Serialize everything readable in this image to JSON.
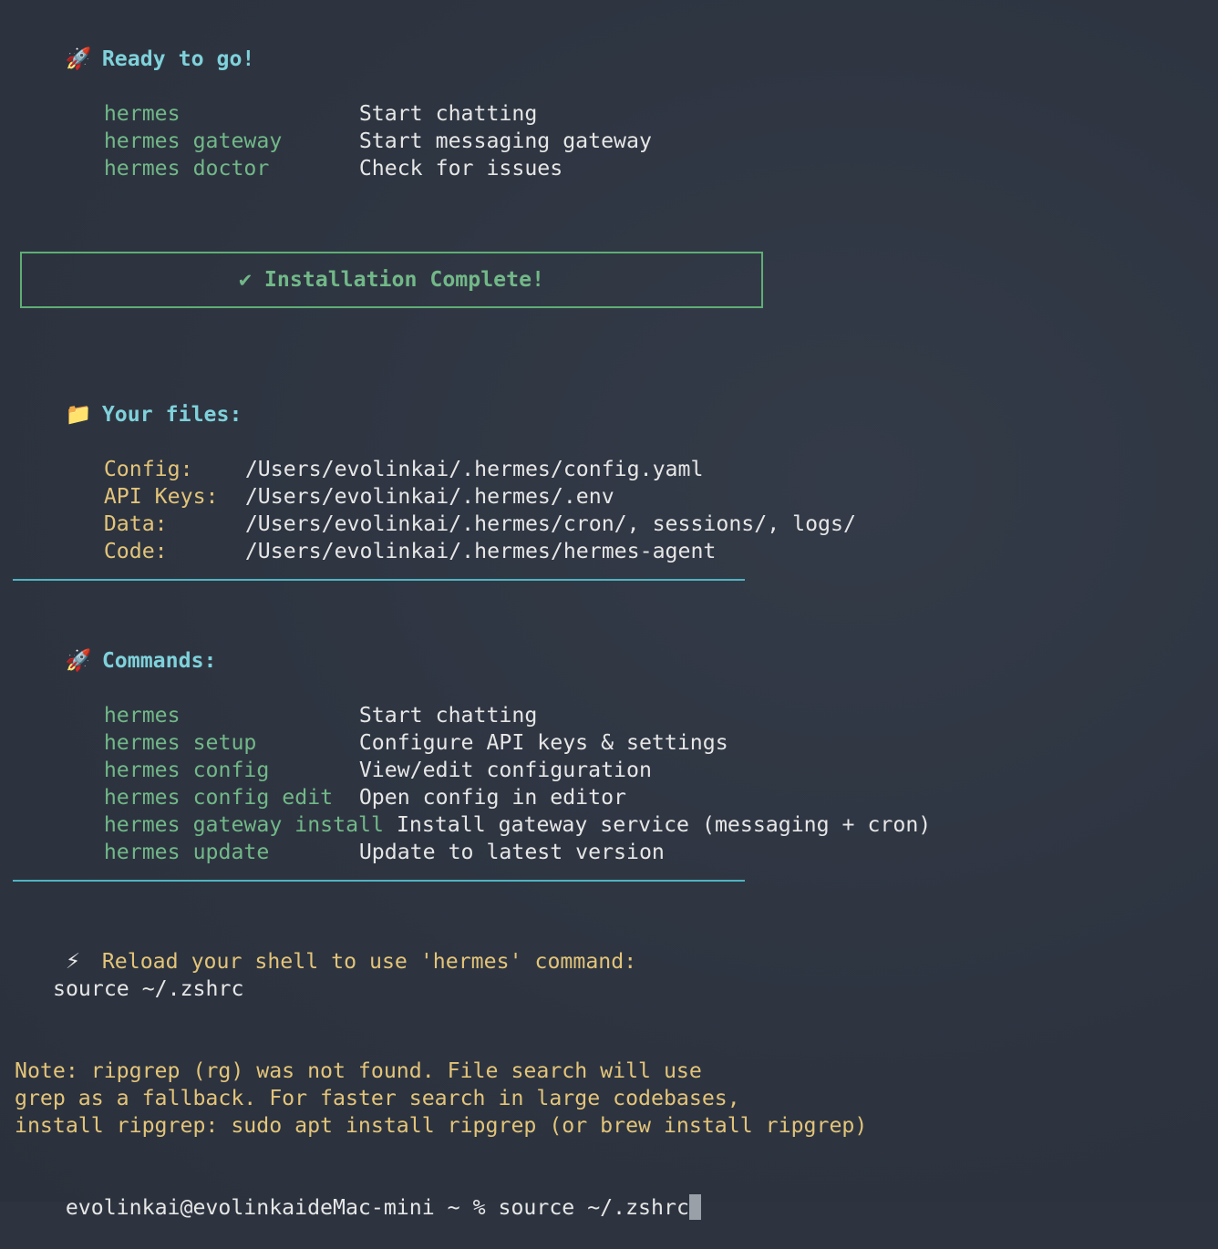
{
  "ready": {
    "icon": "rocket-icon",
    "icon_glyph": "🚀",
    "heading": "Ready to go!",
    "commands": [
      {
        "cmd": "hermes",
        "desc": "Start chatting"
      },
      {
        "cmd": "hermes gateway",
        "desc": "Start messaging gateway"
      },
      {
        "cmd": "hermes doctor",
        "desc": "Check for issues"
      }
    ]
  },
  "banner": {
    "icon": "check-icon",
    "check_glyph": "✔",
    "text": "Installation Complete!",
    "border_color": "#5fae75"
  },
  "files": {
    "icon": "folder-icon",
    "icon_glyph": "📁",
    "heading": "Your files:",
    "items": [
      {
        "label": "Config:",
        "value": "/Users/evolinkai/.hermes/config.yaml"
      },
      {
        "label": "API Keys:",
        "value": "/Users/evolinkai/.hermes/.env"
      },
      {
        "label": "Data:",
        "value": "/Users/evolinkai/.hermes/cron/, sessions/, logs/"
      },
      {
        "label": "Code:",
        "value": "/Users/evolinkai/.hermes/hermes-agent"
      }
    ]
  },
  "commands": {
    "icon": "rocket-icon",
    "icon_glyph": "🚀",
    "heading": "Commands:",
    "items": [
      {
        "cmd": "hermes",
        "desc": "Start chatting"
      },
      {
        "cmd": "hermes setup",
        "desc": "Configure API keys & settings"
      },
      {
        "cmd": "hermes config",
        "desc": "View/edit configuration"
      },
      {
        "cmd": "hermes config edit",
        "desc": "Open config in editor"
      },
      {
        "cmd": "hermes gateway install",
        "desc": "Install gateway service (messaging + cron)"
      },
      {
        "cmd": "hermes update",
        "desc": "Update to latest version"
      }
    ]
  },
  "reload": {
    "icon": "lightning-icon",
    "icon_glyph": "⚡",
    "text": "Reload your shell to use 'hermes' command:",
    "command": "source ~/.zshrc"
  },
  "note": {
    "lines": [
      "Note: ripgrep (rg) was not found. File search will use",
      "grep as a fallback. For faster search in large codebases,",
      "install ripgrep: sudo apt install ripgrep (or brew install ripgrep)"
    ]
  },
  "prompt": {
    "text": "evolinkai@evolinkaideMac-mini ~ % ",
    "input": "source ~/.zshrc"
  },
  "colors": {
    "background": "#2d3440",
    "heading": "#7fd1da",
    "command": "#72b888",
    "label": "#e3c479",
    "rule": "#4fb4c2"
  }
}
